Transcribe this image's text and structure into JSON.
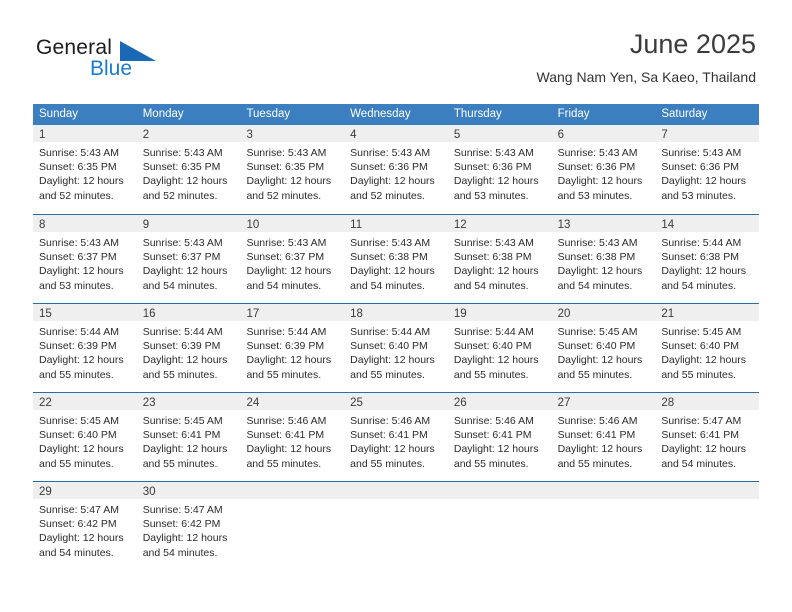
{
  "logo": {
    "text_primary": "General",
    "text_secondary": "Blue",
    "triangle_color": "#1b69b4",
    "secondary_color": "#1b7ad1"
  },
  "header": {
    "title": "June 2025",
    "subtitle": "Wang Nam Yen, Sa Kaeo, Thailand"
  },
  "theme": {
    "header_blue": "#3c7fc1",
    "row_border_blue": "#2e6da4",
    "day_band_gray": "#efefef"
  },
  "weekdays": [
    "Sunday",
    "Monday",
    "Tuesday",
    "Wednesday",
    "Thursday",
    "Friday",
    "Saturday"
  ],
  "weeks": [
    [
      {
        "day": "1",
        "sunrise": "Sunrise: 5:43 AM",
        "sunset": "Sunset: 6:35 PM",
        "daylight_line1": "Daylight: 12 hours",
        "daylight_line2": "and 52 minutes."
      },
      {
        "day": "2",
        "sunrise": "Sunrise: 5:43 AM",
        "sunset": "Sunset: 6:35 PM",
        "daylight_line1": "Daylight: 12 hours",
        "daylight_line2": "and 52 minutes."
      },
      {
        "day": "3",
        "sunrise": "Sunrise: 5:43 AM",
        "sunset": "Sunset: 6:35 PM",
        "daylight_line1": "Daylight: 12 hours",
        "daylight_line2": "and 52 minutes."
      },
      {
        "day": "4",
        "sunrise": "Sunrise: 5:43 AM",
        "sunset": "Sunset: 6:36 PM",
        "daylight_line1": "Daylight: 12 hours",
        "daylight_line2": "and 52 minutes."
      },
      {
        "day": "5",
        "sunrise": "Sunrise: 5:43 AM",
        "sunset": "Sunset: 6:36 PM",
        "daylight_line1": "Daylight: 12 hours",
        "daylight_line2": "and 53 minutes."
      },
      {
        "day": "6",
        "sunrise": "Sunrise: 5:43 AM",
        "sunset": "Sunset: 6:36 PM",
        "daylight_line1": "Daylight: 12 hours",
        "daylight_line2": "and 53 minutes."
      },
      {
        "day": "7",
        "sunrise": "Sunrise: 5:43 AM",
        "sunset": "Sunset: 6:36 PM",
        "daylight_line1": "Daylight: 12 hours",
        "daylight_line2": "and 53 minutes."
      }
    ],
    [
      {
        "day": "8",
        "sunrise": "Sunrise: 5:43 AM",
        "sunset": "Sunset: 6:37 PM",
        "daylight_line1": "Daylight: 12 hours",
        "daylight_line2": "and 53 minutes."
      },
      {
        "day": "9",
        "sunrise": "Sunrise: 5:43 AM",
        "sunset": "Sunset: 6:37 PM",
        "daylight_line1": "Daylight: 12 hours",
        "daylight_line2": "and 54 minutes."
      },
      {
        "day": "10",
        "sunrise": "Sunrise: 5:43 AM",
        "sunset": "Sunset: 6:37 PM",
        "daylight_line1": "Daylight: 12 hours",
        "daylight_line2": "and 54 minutes."
      },
      {
        "day": "11",
        "sunrise": "Sunrise: 5:43 AM",
        "sunset": "Sunset: 6:38 PM",
        "daylight_line1": "Daylight: 12 hours",
        "daylight_line2": "and 54 minutes."
      },
      {
        "day": "12",
        "sunrise": "Sunrise: 5:43 AM",
        "sunset": "Sunset: 6:38 PM",
        "daylight_line1": "Daylight: 12 hours",
        "daylight_line2": "and 54 minutes."
      },
      {
        "day": "13",
        "sunrise": "Sunrise: 5:43 AM",
        "sunset": "Sunset: 6:38 PM",
        "daylight_line1": "Daylight: 12 hours",
        "daylight_line2": "and 54 minutes."
      },
      {
        "day": "14",
        "sunrise": "Sunrise: 5:44 AM",
        "sunset": "Sunset: 6:38 PM",
        "daylight_line1": "Daylight: 12 hours",
        "daylight_line2": "and 54 minutes."
      }
    ],
    [
      {
        "day": "15",
        "sunrise": "Sunrise: 5:44 AM",
        "sunset": "Sunset: 6:39 PM",
        "daylight_line1": "Daylight: 12 hours",
        "daylight_line2": "and 55 minutes."
      },
      {
        "day": "16",
        "sunrise": "Sunrise: 5:44 AM",
        "sunset": "Sunset: 6:39 PM",
        "daylight_line1": "Daylight: 12 hours",
        "daylight_line2": "and 55 minutes."
      },
      {
        "day": "17",
        "sunrise": "Sunrise: 5:44 AM",
        "sunset": "Sunset: 6:39 PM",
        "daylight_line1": "Daylight: 12 hours",
        "daylight_line2": "and 55 minutes."
      },
      {
        "day": "18",
        "sunrise": "Sunrise: 5:44 AM",
        "sunset": "Sunset: 6:40 PM",
        "daylight_line1": "Daylight: 12 hours",
        "daylight_line2": "and 55 minutes."
      },
      {
        "day": "19",
        "sunrise": "Sunrise: 5:44 AM",
        "sunset": "Sunset: 6:40 PM",
        "daylight_line1": "Daylight: 12 hours",
        "daylight_line2": "and 55 minutes."
      },
      {
        "day": "20",
        "sunrise": "Sunrise: 5:45 AM",
        "sunset": "Sunset: 6:40 PM",
        "daylight_line1": "Daylight: 12 hours",
        "daylight_line2": "and 55 minutes."
      },
      {
        "day": "21",
        "sunrise": "Sunrise: 5:45 AM",
        "sunset": "Sunset: 6:40 PM",
        "daylight_line1": "Daylight: 12 hours",
        "daylight_line2": "and 55 minutes."
      }
    ],
    [
      {
        "day": "22",
        "sunrise": "Sunrise: 5:45 AM",
        "sunset": "Sunset: 6:40 PM",
        "daylight_line1": "Daylight: 12 hours",
        "daylight_line2": "and 55 minutes."
      },
      {
        "day": "23",
        "sunrise": "Sunrise: 5:45 AM",
        "sunset": "Sunset: 6:41 PM",
        "daylight_line1": "Daylight: 12 hours",
        "daylight_line2": "and 55 minutes."
      },
      {
        "day": "24",
        "sunrise": "Sunrise: 5:46 AM",
        "sunset": "Sunset: 6:41 PM",
        "daylight_line1": "Daylight: 12 hours",
        "daylight_line2": "and 55 minutes."
      },
      {
        "day": "25",
        "sunrise": "Sunrise: 5:46 AM",
        "sunset": "Sunset: 6:41 PM",
        "daylight_line1": "Daylight: 12 hours",
        "daylight_line2": "and 55 minutes."
      },
      {
        "day": "26",
        "sunrise": "Sunrise: 5:46 AM",
        "sunset": "Sunset: 6:41 PM",
        "daylight_line1": "Daylight: 12 hours",
        "daylight_line2": "and 55 minutes."
      },
      {
        "day": "27",
        "sunrise": "Sunrise: 5:46 AM",
        "sunset": "Sunset: 6:41 PM",
        "daylight_line1": "Daylight: 12 hours",
        "daylight_line2": "and 55 minutes."
      },
      {
        "day": "28",
        "sunrise": "Sunrise: 5:47 AM",
        "sunset": "Sunset: 6:41 PM",
        "daylight_line1": "Daylight: 12 hours",
        "daylight_line2": "and 54 minutes."
      }
    ],
    [
      {
        "day": "29",
        "sunrise": "Sunrise: 5:47 AM",
        "sunset": "Sunset: 6:42 PM",
        "daylight_line1": "Daylight: 12 hours",
        "daylight_line2": "and 54 minutes."
      },
      {
        "day": "30",
        "sunrise": "Sunrise: 5:47 AM",
        "sunset": "Sunset: 6:42 PM",
        "daylight_line1": "Daylight: 12 hours",
        "daylight_line2": "and 54 minutes."
      },
      {
        "day": "",
        "sunrise": "",
        "sunset": "",
        "daylight_line1": "",
        "daylight_line2": ""
      },
      {
        "day": "",
        "sunrise": "",
        "sunset": "",
        "daylight_line1": "",
        "daylight_line2": ""
      },
      {
        "day": "",
        "sunrise": "",
        "sunset": "",
        "daylight_line1": "",
        "daylight_line2": ""
      },
      {
        "day": "",
        "sunrise": "",
        "sunset": "",
        "daylight_line1": "",
        "daylight_line2": ""
      },
      {
        "day": "",
        "sunrise": "",
        "sunset": "",
        "daylight_line1": "",
        "daylight_line2": ""
      }
    ]
  ]
}
